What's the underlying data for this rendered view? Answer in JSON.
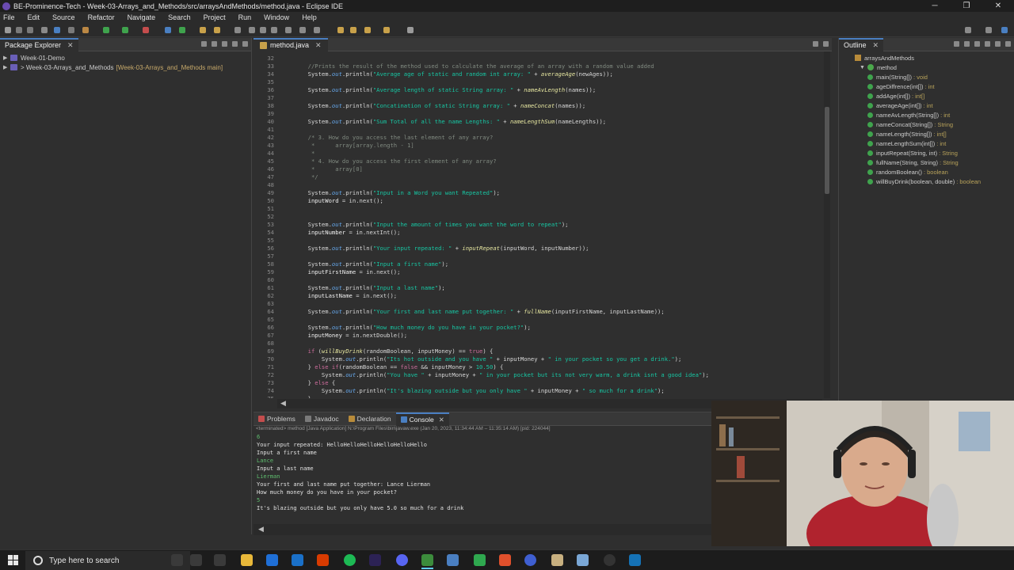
{
  "window": {
    "title": "BE-Prominence-Tech - Week-03-Arrays_and_Methods/src/arraysAndMethods/method.java - Eclipse IDE",
    "controls": [
      "─",
      "❐",
      "✕"
    ]
  },
  "menu": [
    "File",
    "Edit",
    "Source",
    "Refactor",
    "Navigate",
    "Search",
    "Project",
    "Run",
    "Window",
    "Help"
  ],
  "package_explorer": {
    "tab_label": "Package Explorer",
    "items": [
      {
        "label": "Week-01-Demo"
      },
      {
        "label": "> Week-03-Arrays_and_Methods",
        "suffix": "[Week-03-Arrays_and_Methods main]"
      }
    ]
  },
  "editor": {
    "tab_label": "method.java",
    "lines": [
      {
        "n": "32",
        "segs": [
          {
            "c": "t",
            "s": ""
          }
        ]
      },
      {
        "n": "33",
        "segs": [
          {
            "c": "cmt",
            "s": "        //Prints the result of the method used to calculate the average of an array with a random value added"
          }
        ]
      },
      {
        "n": "34",
        "segs": [
          {
            "c": "t",
            "s": "        System."
          },
          {
            "c": "fld",
            "s": "out"
          },
          {
            "c": "t",
            "s": ".println("
          },
          {
            "c": "str",
            "s": "\"Average age of static and random int array: \""
          },
          {
            "c": "t",
            "s": " + "
          },
          {
            "c": "meth",
            "s": "averageAge"
          },
          {
            "c": "t",
            "s": "(newAges));"
          }
        ]
      },
      {
        "n": "35",
        "segs": [
          {
            "c": "t",
            "s": ""
          }
        ]
      },
      {
        "n": "36",
        "segs": [
          {
            "c": "t",
            "s": "        System."
          },
          {
            "c": "fld",
            "s": "out"
          },
          {
            "c": "t",
            "s": ".println("
          },
          {
            "c": "str",
            "s": "\"Average length of static String array: \""
          },
          {
            "c": "t",
            "s": " + "
          },
          {
            "c": "meth",
            "s": "nameAvLength"
          },
          {
            "c": "t",
            "s": "(names));"
          }
        ]
      },
      {
        "n": "37",
        "segs": [
          {
            "c": "t",
            "s": ""
          }
        ]
      },
      {
        "n": "38",
        "segs": [
          {
            "c": "t",
            "s": "        System."
          },
          {
            "c": "fld",
            "s": "out"
          },
          {
            "c": "t",
            "s": ".println("
          },
          {
            "c": "str",
            "s": "\"Concatination of static String array: \""
          },
          {
            "c": "t",
            "s": " + "
          },
          {
            "c": "meth",
            "s": "nameConcat"
          },
          {
            "c": "t",
            "s": "(names));"
          }
        ]
      },
      {
        "n": "39",
        "segs": [
          {
            "c": "t",
            "s": ""
          }
        ]
      },
      {
        "n": "40",
        "segs": [
          {
            "c": "t",
            "s": "        System."
          },
          {
            "c": "fld",
            "s": "out"
          },
          {
            "c": "t",
            "s": ".println("
          },
          {
            "c": "str",
            "s": "\"Sum Total of all the name Lengths: \""
          },
          {
            "c": "t",
            "s": " + "
          },
          {
            "c": "meth",
            "s": "nameLengthSum"
          },
          {
            "c": "t",
            "s": "(nameLengths));"
          }
        ]
      },
      {
        "n": "41",
        "segs": [
          {
            "c": "t",
            "s": ""
          }
        ]
      },
      {
        "n": "42",
        "segs": [
          {
            "c": "cmt",
            "s": "        /* 3. How do you access the last element of any array?"
          }
        ]
      },
      {
        "n": "43",
        "segs": [
          {
            "c": "cmt",
            "s": "         *      array[array.length - 1]"
          }
        ]
      },
      {
        "n": "44",
        "segs": [
          {
            "c": "cmt",
            "s": "         *"
          }
        ]
      },
      {
        "n": "45",
        "segs": [
          {
            "c": "cmt",
            "s": "         * 4. How do you access the first element of any array?"
          }
        ]
      },
      {
        "n": "46",
        "segs": [
          {
            "c": "cmt",
            "s": "         *      array[0]"
          }
        ]
      },
      {
        "n": "47",
        "segs": [
          {
            "c": "cmt",
            "s": "         */"
          }
        ]
      },
      {
        "n": "48",
        "segs": [
          {
            "c": "t",
            "s": ""
          }
        ]
      },
      {
        "n": "49",
        "segs": [
          {
            "c": "t",
            "s": "        System."
          },
          {
            "c": "fld",
            "s": "out"
          },
          {
            "c": "t",
            "s": ".println("
          },
          {
            "c": "str",
            "s": "\"Input in a Word you want Repeated\""
          },
          {
            "c": "t",
            "s": ");"
          }
        ]
      },
      {
        "n": "50",
        "segs": [
          {
            "c": "var",
            "s": "        inputWord"
          },
          {
            "c": "t",
            "s": " = in.next();"
          }
        ]
      },
      {
        "n": "51",
        "segs": [
          {
            "c": "t",
            "s": ""
          }
        ]
      },
      {
        "n": "52",
        "segs": [
          {
            "c": "t",
            "s": ""
          }
        ]
      },
      {
        "n": "53",
        "segs": [
          {
            "c": "t",
            "s": "        System."
          },
          {
            "c": "fld",
            "s": "out"
          },
          {
            "c": "t",
            "s": ".println("
          },
          {
            "c": "str",
            "s": "\"Input the amount of times you want the word to repeat\""
          },
          {
            "c": "t",
            "s": ");"
          }
        ]
      },
      {
        "n": "54",
        "segs": [
          {
            "c": "var",
            "s": "        inputNumber"
          },
          {
            "c": "t",
            "s": " = in.nextInt();"
          }
        ]
      },
      {
        "n": "55",
        "segs": [
          {
            "c": "t",
            "s": ""
          }
        ]
      },
      {
        "n": "56",
        "segs": [
          {
            "c": "t",
            "s": "        System."
          },
          {
            "c": "fld",
            "s": "out"
          },
          {
            "c": "t",
            "s": ".println("
          },
          {
            "c": "str",
            "s": "\"Your input repeated: \""
          },
          {
            "c": "t",
            "s": " + "
          },
          {
            "c": "meth",
            "s": "inputRepeat"
          },
          {
            "c": "t",
            "s": "(inputWord, inputNumber));"
          }
        ]
      },
      {
        "n": "57",
        "segs": [
          {
            "c": "t",
            "s": ""
          }
        ]
      },
      {
        "n": "58",
        "segs": [
          {
            "c": "t",
            "s": "        System."
          },
          {
            "c": "fld",
            "s": "out"
          },
          {
            "c": "t",
            "s": ".println("
          },
          {
            "c": "str",
            "s": "\"Input a first name\""
          },
          {
            "c": "t",
            "s": ");"
          }
        ]
      },
      {
        "n": "59",
        "segs": [
          {
            "c": "var",
            "s": "        inputFirstName"
          },
          {
            "c": "t",
            "s": " = in.next();"
          }
        ]
      },
      {
        "n": "60",
        "segs": [
          {
            "c": "t",
            "s": ""
          }
        ]
      },
      {
        "n": "61",
        "segs": [
          {
            "c": "t",
            "s": "        System."
          },
          {
            "c": "fld",
            "s": "out"
          },
          {
            "c": "t",
            "s": ".println("
          },
          {
            "c": "str",
            "s": "\"Input a last name\""
          },
          {
            "c": "t",
            "s": ");"
          }
        ]
      },
      {
        "n": "62",
        "segs": [
          {
            "c": "var",
            "s": "        inputLastName"
          },
          {
            "c": "t",
            "s": " = in.next();"
          }
        ]
      },
      {
        "n": "63",
        "segs": [
          {
            "c": "t",
            "s": ""
          }
        ]
      },
      {
        "n": "64",
        "segs": [
          {
            "c": "t",
            "s": "        System."
          },
          {
            "c": "fld",
            "s": "out"
          },
          {
            "c": "t",
            "s": ".println("
          },
          {
            "c": "str",
            "s": "\"Your first and last name put together: \""
          },
          {
            "c": "t",
            "s": " + "
          },
          {
            "c": "meth",
            "s": "fullName"
          },
          {
            "c": "t",
            "s": "(inputFirstName, inputLastName));"
          }
        ]
      },
      {
        "n": "65",
        "segs": [
          {
            "c": "t",
            "s": ""
          }
        ]
      },
      {
        "n": "66",
        "segs": [
          {
            "c": "t",
            "s": "        System."
          },
          {
            "c": "fld",
            "s": "out"
          },
          {
            "c": "t",
            "s": ".println("
          },
          {
            "c": "str",
            "s": "\"How much money do you have in your pocket?\""
          },
          {
            "c": "t",
            "s": ");"
          }
        ]
      },
      {
        "n": "67",
        "segs": [
          {
            "c": "var",
            "s": "        inputMoney"
          },
          {
            "c": "t",
            "s": " = in.nextDouble();"
          }
        ]
      },
      {
        "n": "68",
        "segs": [
          {
            "c": "t",
            "s": ""
          }
        ]
      },
      {
        "n": "69",
        "segs": [
          {
            "c": "kw",
            "s": "        if"
          },
          {
            "c": "t",
            "s": " ("
          },
          {
            "c": "meth",
            "s": "willBuyDrink"
          },
          {
            "c": "t",
            "s": "(randomBoolean, inputMoney) == "
          },
          {
            "c": "kw",
            "s": "true"
          },
          {
            "c": "t",
            "s": ") {"
          }
        ]
      },
      {
        "n": "70",
        "segs": [
          {
            "c": "t",
            "s": "            System."
          },
          {
            "c": "fld",
            "s": "out"
          },
          {
            "c": "t",
            "s": ".println("
          },
          {
            "c": "str",
            "s": "\"Its hot outside and you have \""
          },
          {
            "c": "t",
            "s": " + inputMoney + "
          },
          {
            "c": "str",
            "s": "\" in your pocket so you get a drink.\""
          },
          {
            "c": "t",
            "s": ");"
          }
        ]
      },
      {
        "n": "71",
        "segs": [
          {
            "c": "t",
            "s": "        } "
          },
          {
            "c": "kw",
            "s": "else if"
          },
          {
            "c": "t",
            "s": "(randomBoolean == "
          },
          {
            "c": "kw",
            "s": "false"
          },
          {
            "c": "t",
            "s": " && inputMoney > "
          },
          {
            "c": "str",
            "s": "10.50"
          },
          {
            "c": "t",
            "s": ") {"
          }
        ]
      },
      {
        "n": "72",
        "segs": [
          {
            "c": "t",
            "s": "            System."
          },
          {
            "c": "fld",
            "s": "out"
          },
          {
            "c": "t",
            "s": ".println("
          },
          {
            "c": "str",
            "s": "\"You have \""
          },
          {
            "c": "t",
            "s": " + inputMoney + "
          },
          {
            "c": "str",
            "s": "\" in your pocket but its not very warm, a drink isnt a good idea\""
          },
          {
            "c": "t",
            "s": ");"
          }
        ]
      },
      {
        "n": "73",
        "segs": [
          {
            "c": "t",
            "s": "        } "
          },
          {
            "c": "kw",
            "s": "else"
          },
          {
            "c": "t",
            "s": " {"
          }
        ]
      },
      {
        "n": "74",
        "segs": [
          {
            "c": "t",
            "s": "            System."
          },
          {
            "c": "fld",
            "s": "out"
          },
          {
            "c": "t",
            "s": ".println("
          },
          {
            "c": "str",
            "s": "\"It's blazing outside but you only have \""
          },
          {
            "c": "t",
            "s": " + inputMoney + "
          },
          {
            "c": "str",
            "s": "\" so much for a drink\""
          },
          {
            "c": "t",
            "s": ");"
          }
        ]
      },
      {
        "n": "75",
        "segs": [
          {
            "c": "t",
            "s": "        }"
          }
        ]
      }
    ]
  },
  "outline": {
    "tab_label": "Outline",
    "package": "arraysAndMethods",
    "class": "method",
    "members": [
      {
        "name": "main(String[])",
        "ret": ": void"
      },
      {
        "name": "ageDiffrence(int[])",
        "ret": ": int"
      },
      {
        "name": "addAge(int[])",
        "ret": ": int[]"
      },
      {
        "name": "averageAge(int[])",
        "ret": ": int"
      },
      {
        "name": "nameAvLength(String[])",
        "ret": ": int"
      },
      {
        "name": "nameConcat(String[])",
        "ret": ": String"
      },
      {
        "name": "nameLength(String[])",
        "ret": ": int[]"
      },
      {
        "name": "nameLengthSum(int[])",
        "ret": ": int"
      },
      {
        "name": "inputRepeat(String, int)",
        "ret": ": String"
      },
      {
        "name": "fullName(String, String)",
        "ret": ": String"
      },
      {
        "name": "randomBoolean()",
        "ret": ": boolean"
      },
      {
        "name": "willBuyDrink(boolean, double)",
        "ret": ": boolean"
      }
    ]
  },
  "console": {
    "tabs": [
      "Problems",
      "Javadoc",
      "Declaration",
      "Console"
    ],
    "active_tab": "Console",
    "header": "<terminated> method [Java Application] N:\\Program Files\\bin\\javaw.exe (Jan 20, 2023, 11:34:44 AM – 11:35:14 AM) [pid: 224044]",
    "lines": [
      {
        "text": "6",
        "input": true
      },
      {
        "text": "Your input repeated: HelloHelloHelloHelloHelloHello",
        "input": false
      },
      {
        "text": "Input a first name",
        "input": false
      },
      {
        "text": "Lance",
        "input": true
      },
      {
        "text": "Input a last name",
        "input": false
      },
      {
        "text": "Lierman",
        "input": true
      },
      {
        "text": "Your first and last name put together: Lance Lierman",
        "input": false
      },
      {
        "text": "How much money do you have in your pocket?",
        "input": false
      },
      {
        "text": "5",
        "input": true
      },
      {
        "text": "It's blazing outside but you only have 5.0 so much for a drink",
        "input": false
      }
    ]
  },
  "taskbar": {
    "search_placeholder": "Type here to search"
  },
  "colors": {
    "accent": "#4a7fc1",
    "string": "#17c6a3",
    "keyword": "#cc6c9b",
    "comment": "#808a80",
    "console_input": "#5fbf6f"
  }
}
